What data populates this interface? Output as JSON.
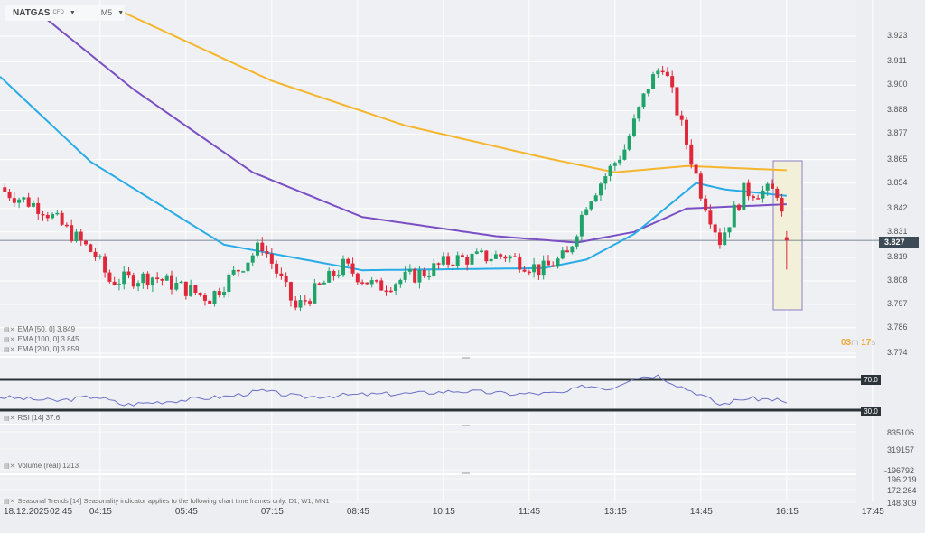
{
  "symbol": {
    "name": "NATGAS",
    "type": "CFD",
    "timeframe": "M5"
  },
  "colors": {
    "up": "#1fa36a",
    "down": "#e0283a",
    "ema50": "#29abe8",
    "ema100": "#7a4fc4",
    "ema200": "#f5b52c",
    "rsi": "#6b6fc8"
  },
  "legend": {
    "ema50": "EMA [50, 0] 3.849",
    "ema100": "EMA [100, 0] 3.845",
    "ema200": "EMA [200, 0] 3.859",
    "rsi": "RSI [14] 37.6",
    "volume": "Volume (real) 1213",
    "seasonal": "Seasonal Trends [14] Seasonality indicator applies to the following chart time frames only: D1, W1, MN1"
  },
  "price_axis": [
    "3.923",
    "3.911",
    "3.900",
    "3.888",
    "3.877",
    "3.865",
    "3.854",
    "3.842",
    "3.831",
    "3.819",
    "3.808",
    "3.797",
    "3.786",
    "3.774"
  ],
  "current_price": "3.827",
  "countdown": {
    "min": "03",
    "m": "m",
    "sec": "17",
    "s": "s"
  },
  "rsi_axis": {
    "upper": "70.0",
    "lower": "30.0"
  },
  "volume_axis": [
    "835106",
    "319157",
    "-196792"
  ],
  "seasonal_axis": [
    "196.219",
    "172.264",
    "148.309"
  ],
  "time_axis": {
    "date": "18.12.2025",
    "labels": [
      "02:45",
      "04:15",
      "05:45",
      "07:15",
      "08:45",
      "10:15",
      "11:45",
      "13:15",
      "14:45",
      "16:15",
      "17:45"
    ]
  },
  "chart_data": {
    "type": "candlestick",
    "interval": "5m",
    "close_path": [
      [
        "02:35",
        3.85
      ],
      [
        "03:15",
        3.842
      ],
      [
        "04:10",
        3.82
      ],
      [
        "04:25",
        3.808
      ],
      [
        "05:10",
        3.81
      ],
      [
        "06:10",
        3.8
      ],
      [
        "07:05",
        3.825
      ],
      [
        "07:40",
        3.795
      ],
      [
        "08:30",
        3.815
      ],
      [
        "09:05",
        3.805
      ],
      [
        "09:55",
        3.812
      ],
      [
        "10:25",
        3.818
      ],
      [
        "11:20",
        3.82
      ],
      [
        "11:58",
        3.813
      ],
      [
        "12:25",
        3.82
      ],
      [
        "12:45",
        3.845
      ],
      [
        "13:25",
        3.87
      ],
      [
        "13:50",
        3.9
      ],
      [
        "14:05",
        3.91
      ],
      [
        "14:20",
        3.888
      ],
      [
        "14:45",
        3.85
      ],
      [
        "15:05",
        3.827
      ],
      [
        "15:30",
        3.85
      ],
      [
        "16:05",
        3.85
      ],
      [
        "16:15",
        3.827
      ]
    ],
    "ema50": [
      [
        "02:30",
        3.904
      ],
      [
        "04:05",
        3.864
      ],
      [
        "06:25",
        3.825
      ],
      [
        "08:50",
        3.813
      ],
      [
        "12:00",
        3.814
      ],
      [
        "12:45",
        3.818
      ],
      [
        "13:35",
        3.83
      ],
      [
        "14:40",
        3.854
      ],
      [
        "15:10",
        3.851
      ],
      [
        "16:15",
        3.848
      ]
    ],
    "ema100": [
      [
        "03:05",
        3.936
      ],
      [
        "04:50",
        3.898
      ],
      [
        "06:55",
        3.859
      ],
      [
        "08:50",
        3.838
      ],
      [
        "11:10",
        3.829
      ],
      [
        "12:35",
        3.826
      ],
      [
        "13:35",
        3.831
      ],
      [
        "14:30",
        3.842
      ],
      [
        "16:15",
        3.844
      ]
    ],
    "ema200": [
      [
        "04:40",
        3.934
      ],
      [
        "07:15",
        3.902
      ],
      [
        "09:35",
        3.881
      ],
      [
        "12:00",
        3.866
      ],
      [
        "13:15",
        3.859
      ],
      [
        "14:30",
        3.862
      ],
      [
        "16:15",
        3.86
      ]
    ],
    "rsi": [
      [
        "02:30",
        47
      ],
      [
        "03:30",
        42
      ],
      [
        "04:10",
        48
      ],
      [
        "04:40",
        37
      ],
      [
        "05:30",
        42
      ],
      [
        "06:30",
        48
      ],
      [
        "07:05",
        55
      ],
      [
        "07:45",
        47
      ],
      [
        "08:45",
        50
      ],
      [
        "09:50",
        52
      ],
      [
        "10:30",
        55
      ],
      [
        "11:30",
        51
      ],
      [
        "12:20",
        52
      ],
      [
        "12:45",
        62
      ],
      [
        "13:10",
        58
      ],
      [
        "13:35",
        73
      ],
      [
        "14:00",
        75
      ],
      [
        "14:20",
        63
      ],
      [
        "14:45",
        50
      ],
      [
        "15:05",
        37
      ],
      [
        "15:30",
        45
      ],
      [
        "16:05",
        44
      ],
      [
        "16:15",
        37.6
      ]
    ],
    "ylim": [
      3.774,
      3.923
    ]
  }
}
